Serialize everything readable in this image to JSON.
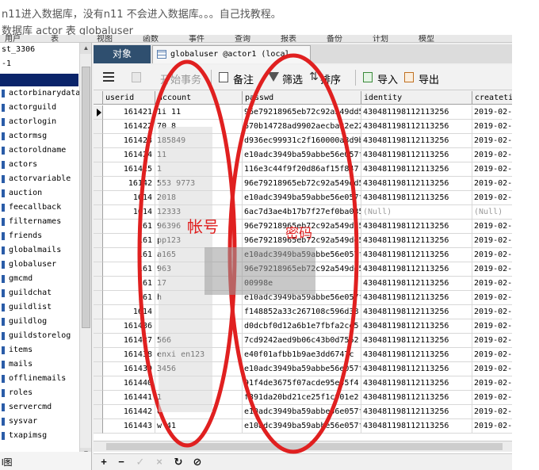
{
  "captions": {
    "line1": "n11进入数据库，没有n11 不会进入数据库。。。自己找教程。",
    "line2": "数据库 actor 表 globaluser"
  },
  "menu": [
    "用户",
    "表",
    "视图",
    "函数",
    "事件",
    "查询",
    "报表",
    "备份",
    "计划",
    "模型"
  ],
  "left_panel": {
    "server": "st_3306",
    "db_line": "-1",
    "tables": [
      "actorbinarydata",
      "actorguild",
      "actorlogin",
      "actormsg",
      "actoroldname",
      "actors",
      "actorvariable",
      "auction",
      "feecallback",
      "filternames",
      "friends",
      "globalmails",
      "globaluser",
      "gmcmd",
      "guildchat",
      "guildlist",
      "guildlog",
      "guildstorelog",
      "items",
      "mails",
      "offlinemails",
      "roles",
      "servercmd",
      "sysvar",
      "txapimsg"
    ],
    "bottom_label": "l图"
  },
  "tabs": {
    "objects": "对象",
    "table_tab": "globaluser @actor1 (local..."
  },
  "toolbar": {
    "begin_tx": "开始事务",
    "note": "备注",
    "filter": "筛选",
    "sort": "排序",
    "import": "导入",
    "export": "导出"
  },
  "grid": {
    "columns": [
      "userid",
      "account",
      "passwd",
      "identity",
      "createti"
    ],
    "rows": [
      {
        "userid": "161421",
        "account": "1i  11",
        "passwd": "96e79218965eb72c92a549dd5",
        "identity": "430481198112113256",
        "created": "2019-02-2"
      },
      {
        "userid": "161422",
        "account": "70  8",
        "passwd": "670b14728ad9902aecba32e22",
        "identity": "430481198112113256",
        "created": "2019-02-2"
      },
      {
        "userid": "161423",
        "account": "  185849",
        "passwd": "d936ec99931c2f160000a8d9b",
        "identity": "430481198112113256",
        "created": "2019-02-2"
      },
      {
        "userid": "161424",
        "account": "  11",
        "passwd": "e10adc3949ba59abbe56e057f",
        "identity": "430481198112113256",
        "created": "2019-02-2"
      },
      {
        "userid": "161425",
        "account": "  1",
        "passwd": "116e3c44f9f20d86af15f847",
        "identity": "430481198112113256",
        "created": "2019-02-2"
      },
      {
        "userid": "16142",
        "account": "553  9773",
        "passwd": "96e79218965eb72c92a549dd5",
        "identity": "430481198112113256",
        "created": "2019-02-2"
      },
      {
        "userid": "1614",
        "account": "2018",
        "passwd": "e10adc3949ba59abbe56e057f",
        "identity": "430481198112113256",
        "created": "2019-02-2"
      },
      {
        "userid": "1614",
        "account": "12333",
        "passwd": "6ac7d3ae4b17b7f27ef0ba035",
        "identity": "(Null)",
        "created": "(Null)"
      },
      {
        "userid": "161",
        "account": "96396",
        "passwd": "96e79218965eb72c92a549dd5",
        "identity": "430481198112113256",
        "created": "2019-02-2"
      },
      {
        "userid": "161",
        "account": "pp123",
        "passwd": "96e79218965eb72c92a549dd5",
        "identity": "430481198112113256",
        "created": "2019-02-2"
      },
      {
        "userid": "161",
        "account": "a165",
        "passwd": "e10adc3949ba59abbe56e057f",
        "identity": "430481198112113256",
        "created": "2019-02-2"
      },
      {
        "userid": "161",
        "account": "963",
        "passwd": "96e79218965eb72c92a549dd5",
        "identity": "430481198112113256",
        "created": "2019-02-2"
      },
      {
        "userid": "161",
        "account": "17",
        "passwd": "00998e",
        "identity": "430481198112113256",
        "created": "2019-02-2"
      },
      {
        "userid": "161",
        "account": "h",
        "passwd": "e10adc3949ba59abbe56e057f",
        "identity": "430481198112113256",
        "created": "2019-02-2"
      },
      {
        "userid": "1614",
        "account": "",
        "passwd": "f148852a33c267108c596d38",
        "identity": "430481198112113256",
        "created": "2019-02-2"
      },
      {
        "userid": "161436",
        "account": "",
        "passwd": "d0dcbf0d12a6b1e7fbfa2ce5",
        "identity": "430481198112113256",
        "created": "2019-02-2"
      },
      {
        "userid": "161437",
        "account": "566",
        "passwd": "7cd9242aed9b06c43b0d7562",
        "identity": "430481198112113256",
        "created": "2019-02-2"
      },
      {
        "userid": "161438",
        "account": "enxi  en123",
        "passwd": "e40f01afbb1b9ae3dd6747c",
        "identity": "430481198112113256",
        "created": "2019-02-2"
      },
      {
        "userid": "161439",
        "account": "3456",
        "passwd": "e10adc3949ba59abbe56e057f",
        "identity": "430481198112113256",
        "created": "2019-02-2"
      },
      {
        "userid": "161440",
        "account": "",
        "passwd": "91f4de3675f07acde95e45f4",
        "identity": "430481198112113256",
        "created": "2019-02-2"
      },
      {
        "userid": "161441",
        "account": "1",
        "passwd": "f391da20bd21ce25f1c901e2",
        "identity": "430481198112113256",
        "created": "2019-02-2"
      },
      {
        "userid": "161442",
        "account": "  o",
        "passwd": "e10adc3949ba59abbe56e057f",
        "identity": "430481198112113256",
        "created": "2019-02-2"
      },
      {
        "userid": "161443",
        "account": "w  41",
        "passwd": "e10adc3949ba59abbe56e057f",
        "identity": "430481198112113256",
        "created": "2019-02-2"
      }
    ]
  },
  "annotations": {
    "account_label": "帐号",
    "password_label": "密码",
    "color": "#e02020"
  },
  "icons": {
    "toolbar_menu": "hamburger-icon",
    "begin_tx": "transaction-icon",
    "note": "note-icon",
    "filter": "filter-icon",
    "sort": "sort-icon",
    "import": "import-icon",
    "export": "export-icon",
    "bottom": [
      "add-icon",
      "remove-icon",
      "check-icon",
      "cancel-icon",
      "refresh-icon",
      "stop-icon"
    ]
  }
}
